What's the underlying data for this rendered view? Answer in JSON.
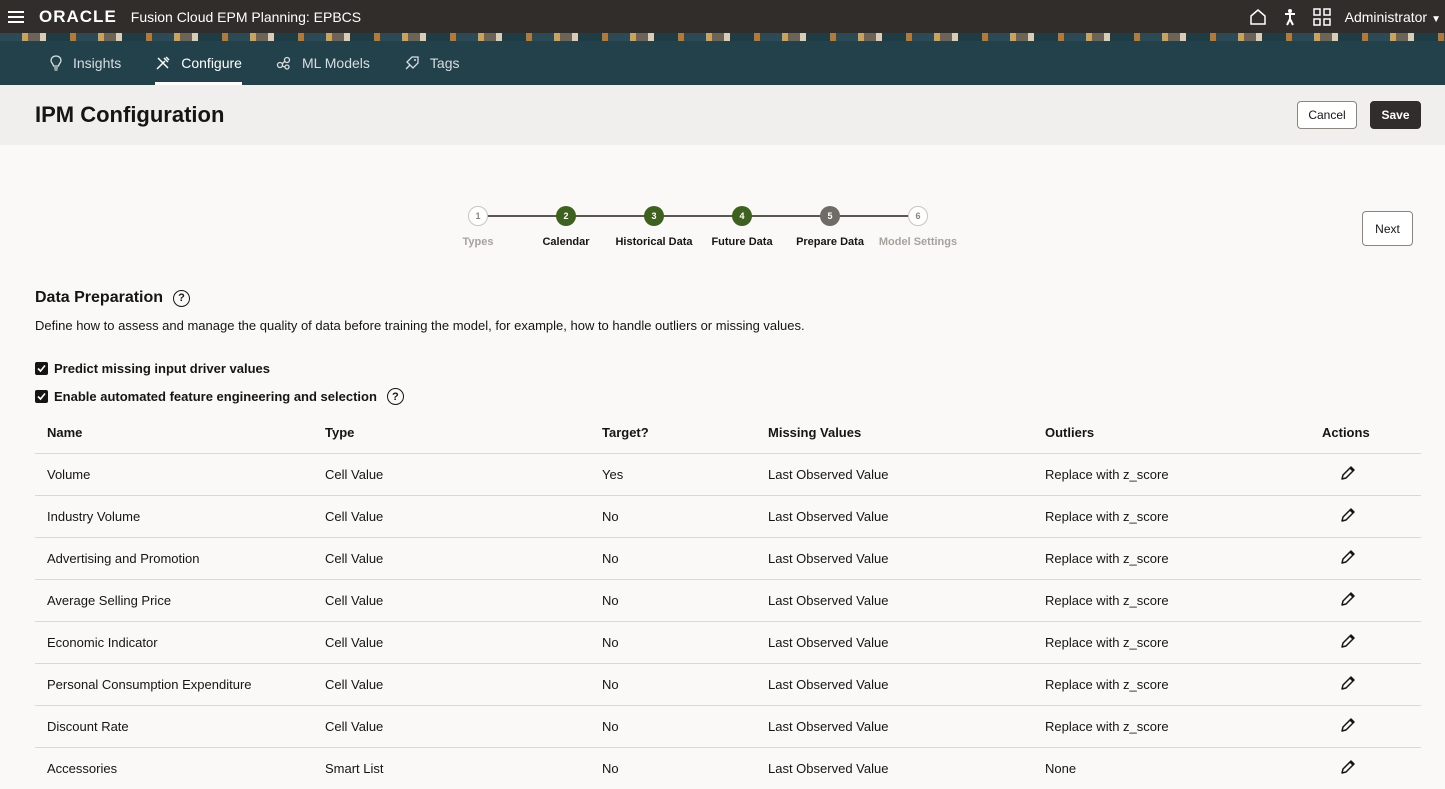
{
  "topbar": {
    "logo": "ORACLE",
    "app_title": "Fusion Cloud EPM Planning:  EPBCS",
    "user": "Administrator"
  },
  "nav": {
    "tabs": [
      {
        "label": "Insights",
        "icon": "lightbulb-icon",
        "active": false
      },
      {
        "label": "Configure",
        "icon": "tools-icon",
        "active": true
      },
      {
        "label": "ML Models",
        "icon": "network-icon",
        "active": false
      },
      {
        "label": "Tags",
        "icon": "tag-icon",
        "active": false
      }
    ]
  },
  "header": {
    "title": "IPM Configuration",
    "cancel_label": "Cancel",
    "save_label": "Save"
  },
  "stepper": {
    "steps": [
      {
        "number": "1",
        "label": "Types",
        "state": "inactive"
      },
      {
        "number": "2",
        "label": "Calendar",
        "state": "done"
      },
      {
        "number": "3",
        "label": "Historical Data",
        "state": "done"
      },
      {
        "number": "4",
        "label": "Future Data",
        "state": "done"
      },
      {
        "number": "5",
        "label": "Prepare Data",
        "state": "current"
      },
      {
        "number": "6",
        "label": "Model Settings",
        "state": "inactive"
      }
    ],
    "next_label": "Next"
  },
  "section": {
    "title": "Data Preparation",
    "description": "Define how to assess and manage the quality of data before training the model, for example, how to handle outliers or missing values.",
    "checkboxes": [
      {
        "label": "Predict missing input driver values",
        "checked": true
      },
      {
        "label": "Enable automated feature engineering and selection",
        "checked": true
      }
    ]
  },
  "table": {
    "headers": [
      "Name",
      "Type",
      "Target?",
      "Missing Values",
      "Outliers",
      "Actions"
    ],
    "rows": [
      [
        "Volume",
        "Cell Value",
        "Yes",
        "Last Observed Value",
        "Replace with z_score"
      ],
      [
        "Industry Volume",
        "Cell Value",
        "No",
        "Last Observed Value",
        "Replace with z_score"
      ],
      [
        "Advertising and Promotion",
        "Cell Value",
        "No",
        "Last Observed Value",
        "Replace with z_score"
      ],
      [
        "Average Selling Price",
        "Cell Value",
        "No",
        "Last Observed Value",
        "Replace with z_score"
      ],
      [
        "Economic Indicator",
        "Cell Value",
        "No",
        "Last Observed Value",
        "Replace with z_score"
      ],
      [
        "Personal Consumption Expenditure",
        "Cell Value",
        "No",
        "Last Observed Value",
        "Replace with z_score"
      ],
      [
        "Discount Rate",
        "Cell Value",
        "No",
        "Last Observed Value",
        "Replace with z_score"
      ],
      [
        "Accessories",
        "Smart List",
        "No",
        "Last Observed Value",
        "None"
      ]
    ]
  },
  "colors": {
    "topbar": "#312d2a",
    "navbar": "#23414a",
    "step_done": "#3f6120",
    "step_current": "#6f6b66",
    "save_button": "#312d2a"
  }
}
